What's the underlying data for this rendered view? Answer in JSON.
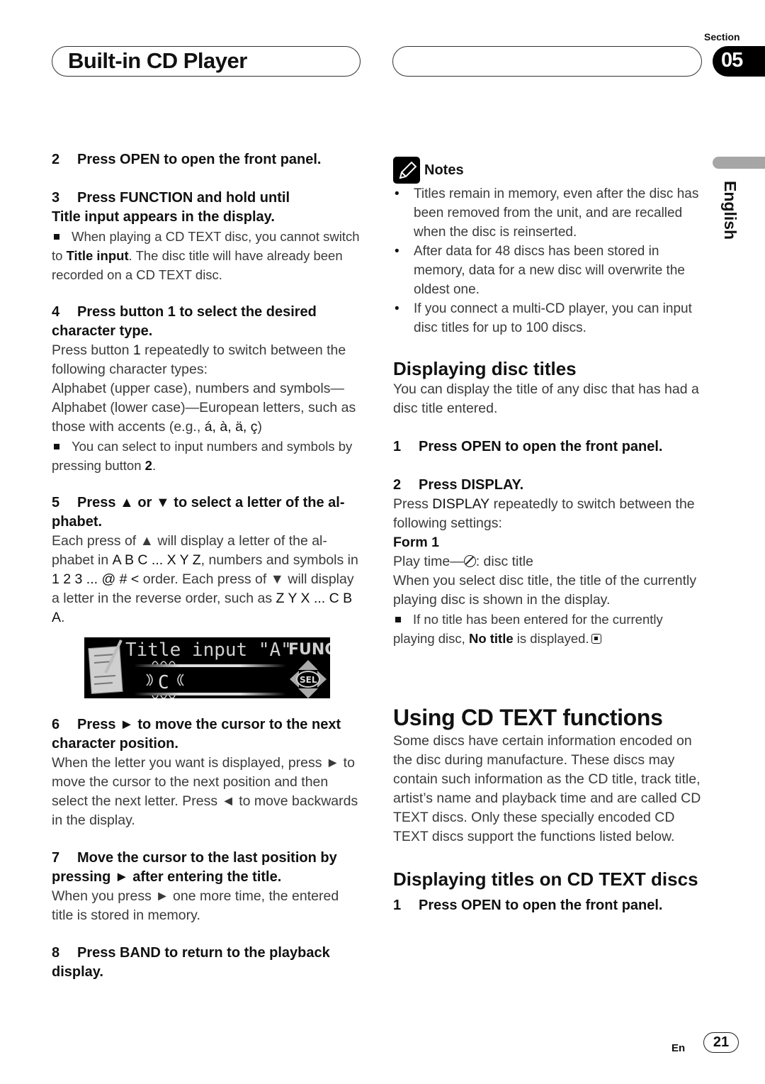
{
  "header": {
    "title": "Built-in CD Player",
    "section_label": "Section",
    "section_number": "05"
  },
  "side_tab": {
    "language": "English"
  },
  "left": {
    "step2": {
      "num": "2",
      "text": "Press OPEN to open the front panel."
    },
    "step3": {
      "num": "3",
      "text_a": "Press FUNCTION and hold until",
      "text_b": "Title input appears in the display."
    },
    "step3_note": {
      "pre": "When playing a CD TEXT disc, you cannot switch to ",
      "bold": "Title input",
      "post": ". The disc title will have al­ready been recorded on a CD TEXT disc."
    },
    "step4": {
      "num": "4",
      "text": "Press button 1 to select the desired character type."
    },
    "step4_body": {
      "pre": "Press button ",
      "bold": "1",
      "post": " repeatedly to switch between the following character types:",
      "types": "Alphabet (upper case), numbers and symbols—Alphabet (lower case)—European letters, such as those with accents (e.g., ",
      "accents": "á, à, ä, ç",
      "close": ")"
    },
    "step4_note": {
      "pre": "You can select to input numbers and symbols by pressing button ",
      "bold": "2",
      "post": "."
    },
    "step5": {
      "num": "5",
      "text": "Press ▲ or ▼ to select a letter of the al­phabet."
    },
    "step5_body": {
      "a": "Each press of ▲ will display a letter of the al­phabet in ",
      "b_bold": "A B C ... X Y Z",
      "c": ", numbers and sym­bols in ",
      "d_bold": "1 2 3 ... @ # <",
      "e": " order. Each press of ▼ will display a letter in the reverse order, such as ",
      "f_bold": "Z Y X ... C B A",
      "g": "."
    },
    "display": {
      "title": "Title input \"A\"",
      "func": "FUNC",
      "cursor_char": "C",
      "sel": "SEL"
    },
    "step6": {
      "num": "6",
      "text": "Press ► to move the cursor to the next character position."
    },
    "step6_body": "When the letter you want is displayed, press ► to move the cursor to the next position and then select the next letter. Press ◄ to move backwards in the display.",
    "step7": {
      "num": "7",
      "text": "Move the cursor to the last position by pressing ► after entering the title."
    },
    "step7_body": "When you press ► one more time, the entered title is stored in memory.",
    "step8": {
      "num": "8",
      "text": "Press BAND to return to the playback display."
    }
  },
  "right": {
    "notes_label": "Notes",
    "notes": [
      "Titles remain in memory, even after the disc has been removed from the unit, and are re­called when the disc is reinserted.",
      "After data for 48 discs has been stored in memory, data for a new disc will overwrite the oldest one.",
      "If you connect a multi-CD player, you can input disc titles for up to 100 discs."
    ],
    "disp_heading": "Displaying disc titles",
    "disp_intro": "You can display the title of any disc that has had a disc title entered.",
    "disp_step1": {
      "num": "1",
      "text": "Press OPEN to open the front panel."
    },
    "disp_step2": {
      "num": "2",
      "text": "Press DISPLAY."
    },
    "disp_step2_body": {
      "pre": "Press ",
      "bold": "DISPLAY",
      "post": " repeatedly to switch between the following settings:"
    },
    "form_label": "Form 1",
    "form_line": {
      "pre": "Play time—",
      "post": ": disc title"
    },
    "form_body": "When you select disc title, the title of the cur­rently playing disc is shown in the display.",
    "form_note": {
      "pre": "If no title has been entered for the currently playing disc, ",
      "bold": "No title",
      "post": " is displayed."
    },
    "cdtext_heading": "Using CD TEXT functions",
    "cdtext_body": "Some discs have certain information encoded on the disc during manufacture. These discs may contain such information as the CD title, track title, artist’s name and playback time and are called CD TEXT discs. Only these spe­cially encoded CD TEXT discs support the functions listed below.",
    "cdtitles_heading": "Displaying titles on CD TEXT discs",
    "cdtitles_step1": {
      "num": "1",
      "text": "Press OPEN to open the front panel."
    }
  },
  "footer": {
    "lang_code": "En",
    "page": "21"
  }
}
